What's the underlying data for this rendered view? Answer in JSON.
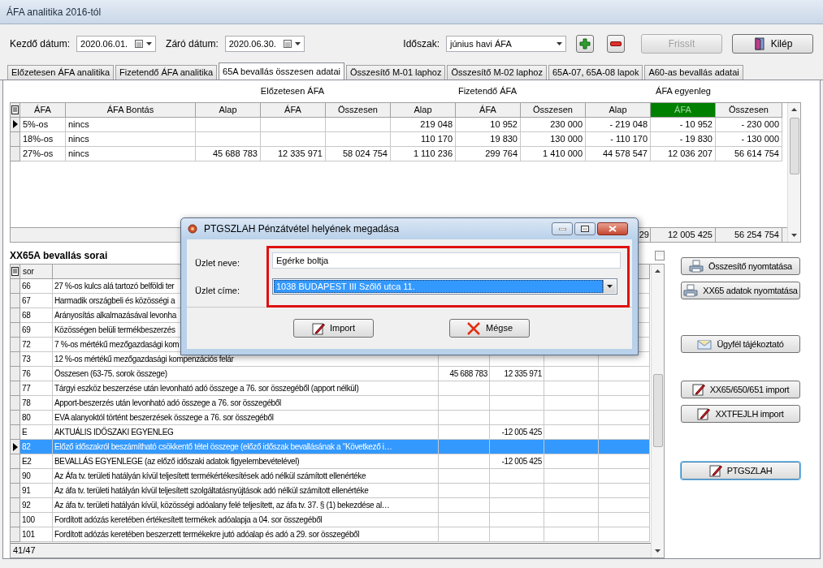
{
  "window": {
    "title": "ÁFA analitika 2016-tól"
  },
  "toolbar": {
    "start_date": {
      "label": "Kezdő dátum:",
      "value": "2020.06.01."
    },
    "end_date": {
      "label": "Záró dátum:",
      "value": "2020.06.30."
    },
    "period": {
      "label": "Időszak:",
      "value": "június havi ÁFA"
    },
    "buttons": [
      {
        "label": "Frissít",
        "disabled": true,
        "kind": "plain"
      },
      {
        "label": "Kilép",
        "disabled": false,
        "kind": "door"
      }
    ]
  },
  "tabs": [
    {
      "label": "Előzetesen ÁFA analitika",
      "selected": false
    },
    {
      "label": "Fizetendő ÁFA analitika",
      "selected": false
    },
    {
      "label": "65A bevallás összesen adatai",
      "selected": true
    },
    {
      "label": "Összesítő M-01 laphoz",
      "selected": false
    },
    {
      "label": "Összesítő M-02 laphoz",
      "selected": false
    },
    {
      "label": "65A-07, 65A-08 lapok",
      "selected": false
    },
    {
      "label": "A60-as bevallás adatai",
      "selected": false
    }
  ],
  "summary_grid": {
    "group_headers": [
      "Előzetesen ÁFA",
      "Fizetendő ÁFA",
      "ÁFA egyenleg"
    ],
    "columns": [
      {
        "label": "ÁFA",
        "highlighted": false
      },
      {
        "label": "ÁFA Bontás",
        "highlighted": false
      },
      {
        "label": "Alap",
        "highlighted": false
      },
      {
        "label": "ÁFA",
        "highlighted": false
      },
      {
        "label": "Összesen",
        "highlighted": false
      },
      {
        "label": "Alap",
        "highlighted": false
      },
      {
        "label": "ÁFA",
        "highlighted": false
      },
      {
        "label": "Összesen",
        "highlighted": false
      },
      {
        "label": "Alap",
        "highlighted": false
      },
      {
        "label": "ÁFA",
        "highlighted": true
      },
      {
        "label": "Összesen",
        "highlighted": false
      }
    ],
    "rows": [
      {
        "current": true,
        "cells": [
          "5%-os",
          "nincs",
          "",
          "",
          "",
          "219 048",
          "10 952",
          "230 000",
          "- 219 048",
          "- 10 952",
          "- 230 000"
        ]
      },
      {
        "current": false,
        "cells": [
          "18%-os",
          "nincs",
          "",
          "",
          "",
          "110 170",
          "19 830",
          "130 000",
          "- 110 170",
          "- 19 830",
          "- 130 000"
        ]
      },
      {
        "current": false,
        "cells": [
          "27%-os",
          "nincs",
          "45 688 783",
          "12 335 971",
          "58 024 754",
          "1 110 236",
          "299 764",
          "1 410 000",
          "44 578 547",
          "12 036 207",
          "56 614 754"
        ]
      }
    ],
    "footer": [
      "29",
      "12 005 425",
      "56 254 754"
    ]
  },
  "lines_grid": {
    "title": "XX65A bevallás sorai",
    "checkbox": {
      "checked": false
    },
    "columns": [
      "sor"
    ],
    "rows": [
      {
        "current": false,
        "selected": false,
        "cells": [
          "66",
          "27 %-os kulcs alá tartozó belföldi ter",
          "",
          "",
          "",
          ""
        ]
      },
      {
        "current": false,
        "selected": false,
        "cells": [
          "67",
          "Harmadik országbeli és közösségi a",
          "",
          "",
          "",
          ""
        ]
      },
      {
        "current": false,
        "selected": false,
        "cells": [
          "68",
          "Arányosítás alkalmazásával levonha",
          "",
          "",
          "",
          ""
        ]
      },
      {
        "current": false,
        "selected": false,
        "cells": [
          "69",
          "Közösségen belüli termékbeszerzés",
          "",
          "",
          "",
          ""
        ]
      },
      {
        "current": false,
        "selected": false,
        "cells": [
          "72",
          "7 %-os mértékű mezőgazdasági kom",
          "",
          "",
          "",
          ""
        ]
      },
      {
        "current": false,
        "selected": false,
        "cells": [
          "73",
          "12 %-os mértékű mezőgazdasági kompenzációs felár",
          "",
          "",
          "",
          ""
        ]
      },
      {
        "current": false,
        "selected": false,
        "cells": [
          "76",
          "Összesen (63-75. sorok összege)",
          "45 688 783",
          "12 335 971",
          "",
          ""
        ]
      },
      {
        "current": false,
        "selected": false,
        "cells": [
          "77",
          "Tárgyi eszköz beszerzése után levonható adó összege a 76. sor összegéből (apport nélkül)",
          "",
          "",
          "",
          ""
        ]
      },
      {
        "current": false,
        "selected": false,
        "cells": [
          "78",
          "Apport-beszerzés után levonható adó összege a 76. sor összegéből",
          "",
          "",
          "",
          ""
        ]
      },
      {
        "current": false,
        "selected": false,
        "cells": [
          "80",
          "EVA alanyoktól történt beszerzések összege a 76. sor összegéből",
          "",
          "",
          "",
          ""
        ]
      },
      {
        "current": false,
        "selected": false,
        "cells": [
          "E",
          "AKTUÁLIS IDŐSZAKI EGYENLEG",
          "",
          "-12 005 425",
          "",
          ""
        ]
      },
      {
        "current": true,
        "selected": true,
        "cells": [
          "82",
          "Előző időszakról beszámítható csökkentő tétel összege (előző időszak bevallásának a \"Következő i…",
          "",
          "",
          "",
          ""
        ]
      },
      {
        "current": false,
        "selected": false,
        "cells": [
          "E2",
          "BEVALLÁS EGYENLEGE (az előző időszaki adatok figyelembevételével)",
          "",
          "-12 005 425",
          "",
          ""
        ]
      },
      {
        "current": false,
        "selected": false,
        "cells": [
          "90",
          "Az Áfa tv. területi hatályán kívül teljesített termékértékesítések adó nélkül számított ellenértéke",
          "",
          "",
          "",
          ""
        ]
      },
      {
        "current": false,
        "selected": false,
        "cells": [
          "91",
          "Az áfa tv. területi hatályán kívül teljesített szolgáltatásnyújtások adó nélkül számított ellenértéke",
          "",
          "",
          "",
          ""
        ]
      },
      {
        "current": false,
        "selected": false,
        "cells": [
          "92",
          "Az áfa tv. területi hatályán kívül, közösségi adóalany felé teljesített, az áfa tv. 37. § (1) bekezdése al…",
          "",
          "",
          "",
          ""
        ]
      },
      {
        "current": false,
        "selected": false,
        "cells": [
          "100",
          "Fordított adózás keretében értékesített termékek adóalapja a 04. sor összegéből",
          "",
          "",
          "",
          ""
        ]
      },
      {
        "current": false,
        "selected": false,
        "cells": [
          "101",
          "Fordított adózás keretében beszerzett termékekre jutó adóalap és adó a 29. sor összegéből",
          "",
          "",
          "",
          ""
        ]
      }
    ],
    "status": "41/47"
  },
  "side_buttons": [
    {
      "label": "Összesítő nyomtatása",
      "kind": "printer",
      "focused": false
    },
    {
      "label": "XX65 adatok nyomtatása",
      "kind": "printer",
      "focused": false
    },
    {
      "label": "Ügyfél tájékoztató",
      "kind": "envelope",
      "focused": false
    },
    {
      "label": "XX65/650/651 import",
      "kind": "pencil",
      "focused": false
    },
    {
      "label": "XXTFEJLH import",
      "kind": "pencil",
      "focused": false
    },
    {
      "label": "PTGSZLAH",
      "kind": "pencil",
      "focused": true
    }
  ],
  "dialog": {
    "title": "PTGSZLAH Pénzátvétel helyének megadása",
    "fields": [
      {
        "label": "Üzlet neve:",
        "kind": "text",
        "value": "Egérke boltja"
      },
      {
        "label": "Üzlet címe:",
        "kind": "select",
        "value": "1038 BUDAPEST III Szőlő utca 11."
      }
    ],
    "buttons": [
      {
        "label": "Import",
        "kind": "pencil"
      },
      {
        "label": "Mégse",
        "kind": "cross"
      }
    ]
  }
}
